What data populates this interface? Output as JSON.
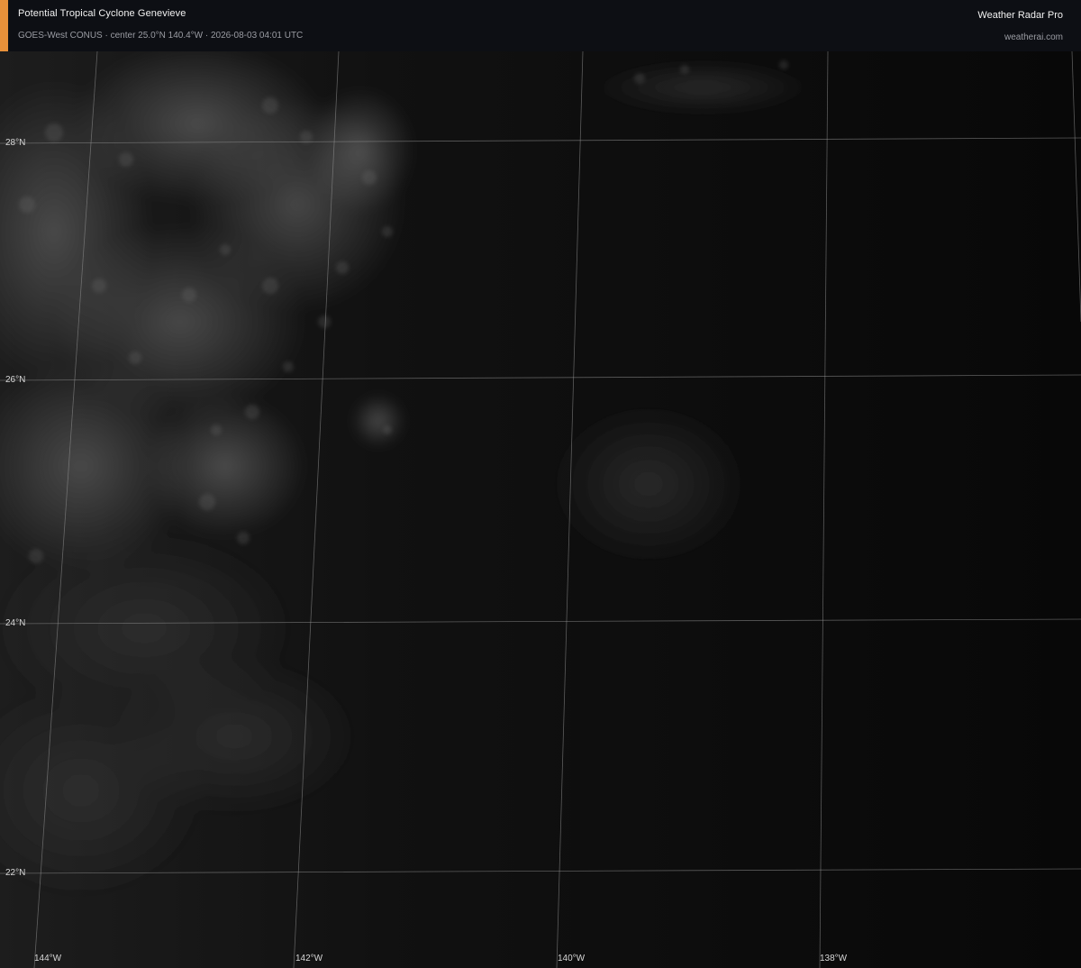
{
  "header": {
    "title": "Potential Tropical Cyclone Genevieve",
    "subtitle": "GOES-West CONUS · center 25.0°N 140.4°W · 2026-08-03 04:01 UTC",
    "brand": "Weather Radar Pro",
    "site": "weatherai.com",
    "accent_color": "#e8913a"
  },
  "map": {
    "imagery": "visible satellite, night",
    "latitude_labels": [
      "28°N",
      "26°N",
      "24°N",
      "22°N"
    ],
    "longitude_labels": [
      "144°W",
      "142°W",
      "140°W",
      "138°W"
    ],
    "grid_color": "#9b9b9b"
  }
}
